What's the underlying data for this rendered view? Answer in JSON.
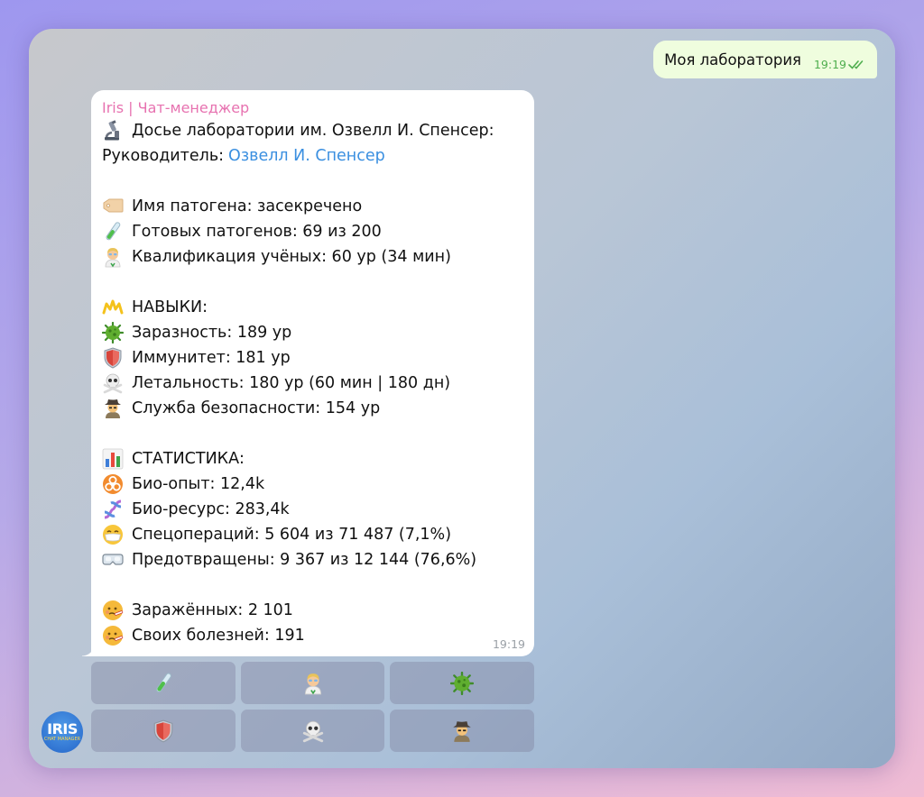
{
  "outgoing": {
    "text": "Моя лаборатория",
    "time": "19:19"
  },
  "message": {
    "sender": "Iris | Чат-менеджер",
    "title": "Досье лаборатории им. Озвелл И. Спенсер:",
    "head_label": "Руководитель: ",
    "head_name": "Озвелл И. Спенсер",
    "pathogen_name": "Имя патогена: засекречено",
    "ready": "Готовых патогенов: 69 из 200",
    "qualification": "Квалификация учёных: 60 ур (34 мин)",
    "skills_header": "НАВЫКИ:",
    "contagion": "Заразность: 189 ур",
    "immunity": "Иммунитет: 181 ур",
    "lethality": "Летальность: 180 ур (60 мин | 180 дн)",
    "security": "Служба безопасности: 154 ур",
    "stats_header": "СТАТИСТИКА:",
    "bio_exp": "Био-опыт: 12,4k",
    "bio_res": "Био-ресурс: 283,4k",
    "specops": "Спецопераций: 5 604 из 71 487 (7,1%)",
    "prevented": "Предотвращены: 9 367 из 12 144 (76,6%)",
    "infected": "Заражённых: 2 101",
    "diseases": "Своих болезней: 191",
    "time": "19:19"
  },
  "keyboard": {
    "rows": [
      [
        "test-tube-icon",
        "scientist-icon",
        "virus-icon"
      ],
      [
        "shield-icon",
        "skull-icon",
        "detective-icon"
      ]
    ]
  },
  "avatar": {
    "big": "IRIS",
    "small": "CHAT MANAGER"
  },
  "colors": {
    "outgoing_bubble": "#effdde",
    "sender": "#e772b0",
    "link": "#3a8fe0",
    "time_out": "#4fae4e"
  }
}
